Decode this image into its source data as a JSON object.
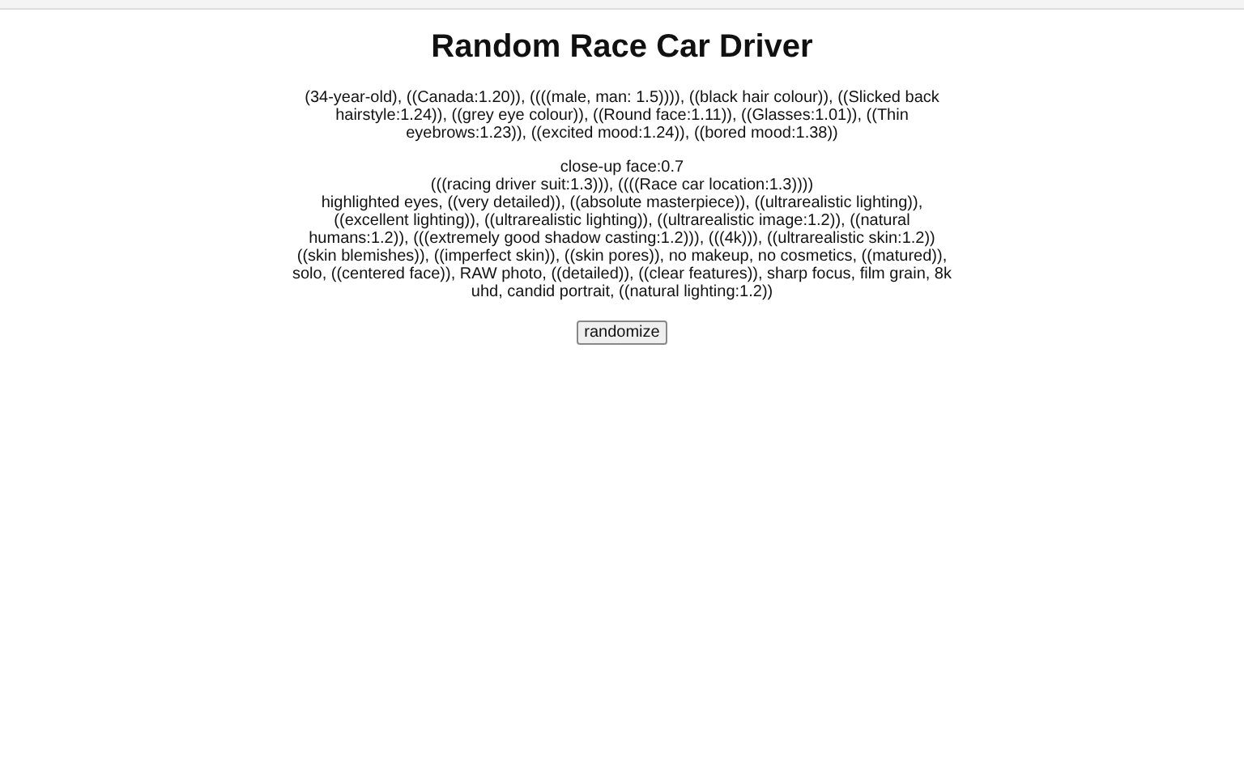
{
  "title": "Random Race Car Driver",
  "prompt_blocks": [
    {
      "lines": [
        "(34-year-old), ((Canada:1.20)), ((((male, man: 1.5)))), ((black hair colour)), ((Slicked back hairstyle:1.24)), ((grey eye colour)), ((Round face:1.11)), ((Glasses:1.01)), ((Thin eyebrows:1.23)), ((excited mood:1.24)), ((bored mood:1.38))"
      ]
    },
    {
      "lines": [
        "close-up face:0.7",
        "(((racing driver suit:1.3))), ((((Race car location:1.3))))",
        "highlighted eyes, ((very detailed)), ((absolute masterpiece)), ((ultrarealistic lighting)), ((excellent lighting)), ((ultrarealistic lighting)), ((ultrarealistic image:1.2)), ((natural humans:1.2)), (((extremely good shadow casting:1.2))), (((4k))), ((ultrarealistic skin:1.2))",
        "((skin blemishes)), ((imperfect skin)), ((skin pores)), no makeup, no cosmetics, ((matured)), solo, ((centered face)), RAW photo, ((detailed)), ((clear features)), sharp focus, film grain, 8k uhd, candid portrait, ((natural lighting:1.2))"
      ]
    }
  ],
  "button": "randomize"
}
